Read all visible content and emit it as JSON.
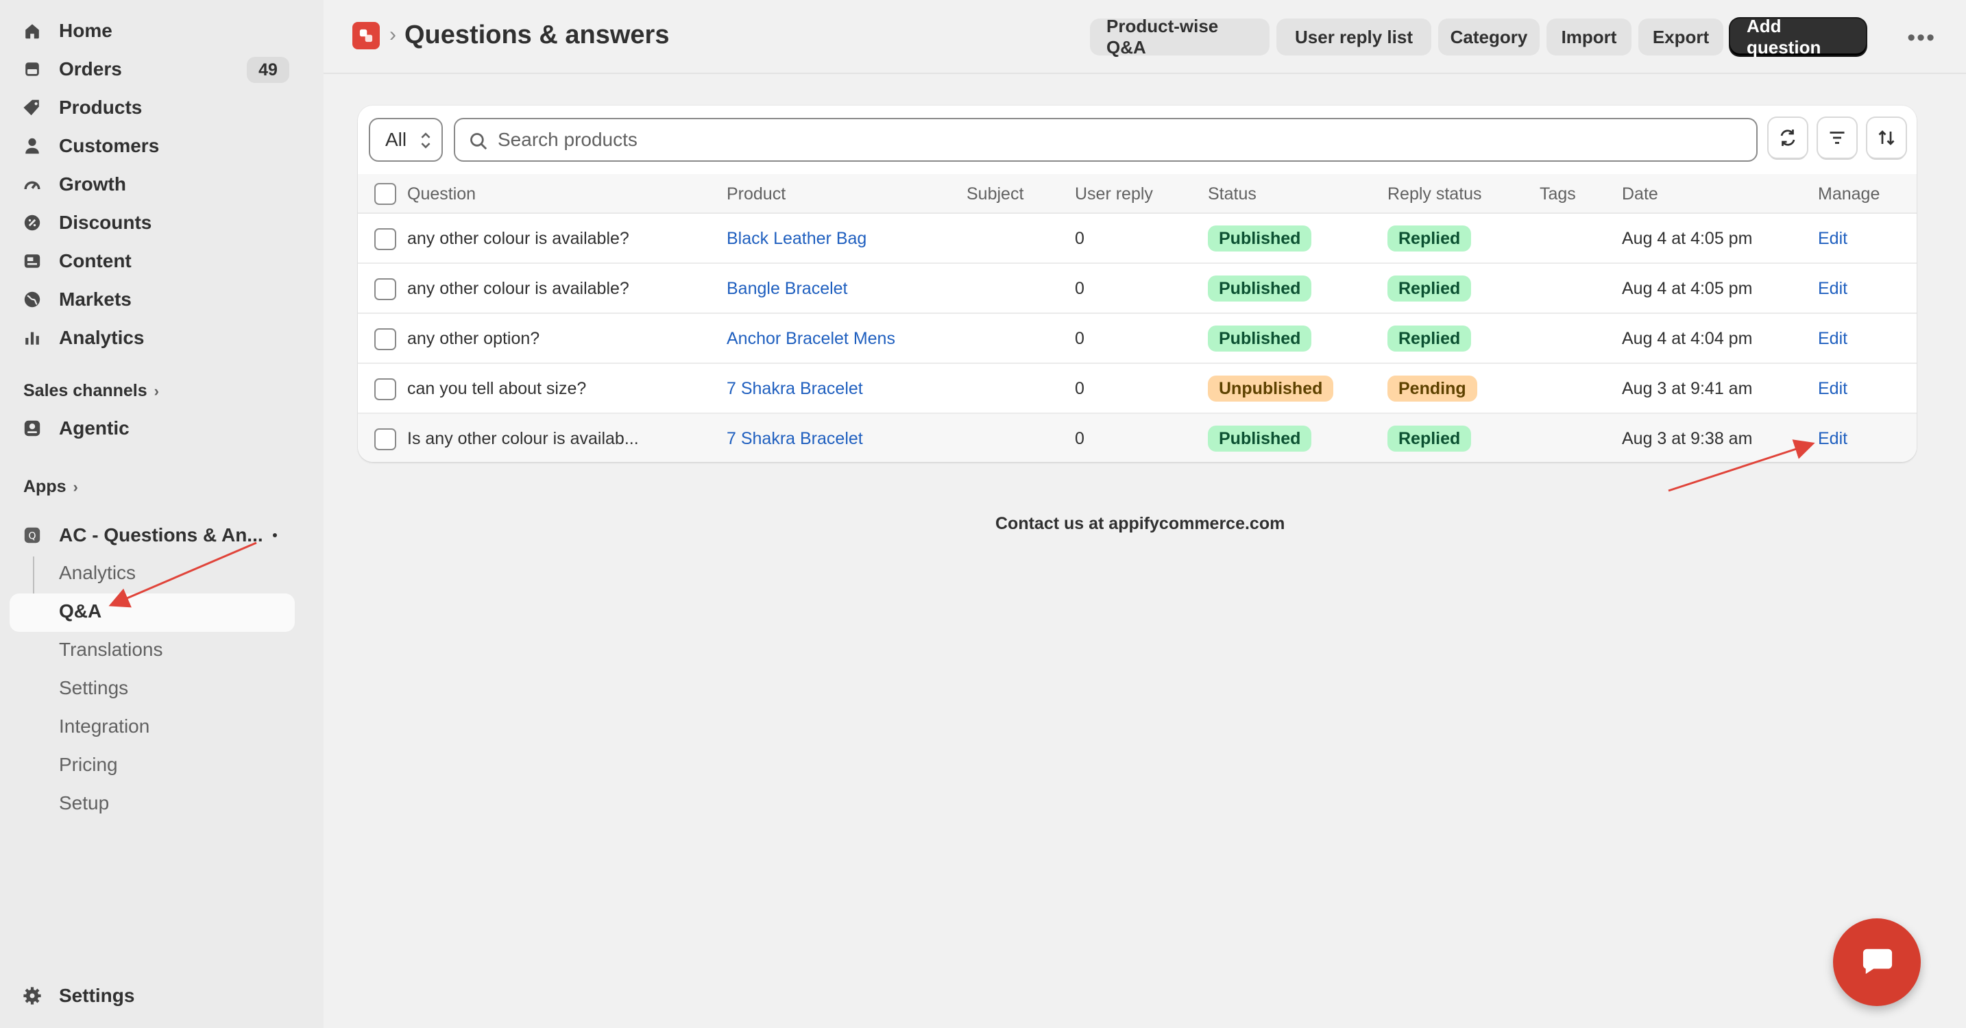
{
  "sidebar": {
    "nav": [
      {
        "label": "Home",
        "icon": "home-icon"
      },
      {
        "label": "Orders",
        "icon": "orders-icon",
        "badge": "49"
      },
      {
        "label": "Products",
        "icon": "tag-icon"
      },
      {
        "label": "Customers",
        "icon": "person-icon"
      },
      {
        "label": "Growth",
        "icon": "gauge-icon"
      },
      {
        "label": "Discounts",
        "icon": "discount-icon"
      },
      {
        "label": "Content",
        "icon": "content-icon"
      },
      {
        "label": "Markets",
        "icon": "globe-icon"
      },
      {
        "label": "Analytics",
        "icon": "bar-chart-icon"
      }
    ],
    "sales_channels": "Sales channels",
    "agentic": "Agentic",
    "apps": "Apps",
    "app_name": "AC - Questions & An...",
    "app_sub": [
      "Analytics",
      "Q&A",
      "Translations",
      "Settings",
      "Integration",
      "Pricing",
      "Setup"
    ],
    "settings": "Settings"
  },
  "header": {
    "title": "Questions & answers",
    "buttons": [
      "Product-wise Q&A",
      "User reply list",
      "Category",
      "Import",
      "Export"
    ],
    "primary": "Add question",
    "more": "•••"
  },
  "toolbar": {
    "filter_value": "All",
    "search_placeholder": "Search products"
  },
  "table": {
    "headers": [
      "Question",
      "Product",
      "Subject",
      "User reply",
      "Status",
      "Reply status",
      "Tags",
      "Date",
      "Manage"
    ],
    "rows": [
      {
        "question": "any other colour is available?",
        "product": "Black Leather Bag",
        "subject": "",
        "user_reply": "0",
        "status": "Published",
        "reply_status": "Replied",
        "tags": "",
        "date": "Aug 4 at 4:05 pm",
        "manage": "Edit"
      },
      {
        "question": "any other colour is available?",
        "product": "Bangle Bracelet",
        "subject": "",
        "user_reply": "0",
        "status": "Published",
        "reply_status": "Replied",
        "tags": "",
        "date": "Aug 4 at 4:05 pm",
        "manage": "Edit"
      },
      {
        "question": "any other option?",
        "product": "Anchor Bracelet Mens",
        "subject": "",
        "user_reply": "0",
        "status": "Published",
        "reply_status": "Replied",
        "tags": "",
        "date": "Aug 4 at 4:04 pm",
        "manage": "Edit"
      },
      {
        "question": "can you tell about size?",
        "product": "7 Shakra Bracelet",
        "subject": "",
        "user_reply": "0",
        "status": "Unpublished",
        "reply_status": "Pending",
        "tags": "",
        "date": "Aug 3 at 9:41 am",
        "manage": "Edit"
      },
      {
        "question": "Is any other colour is availab...",
        "product": "7 Shakra Bracelet",
        "subject": "",
        "user_reply": "0",
        "status": "Published",
        "reply_status": "Replied",
        "tags": "",
        "date": "Aug 3 at 9:38 am",
        "manage": "Edit"
      }
    ]
  },
  "footer": {
    "contact": "Contact us at appifycommerce.com"
  },
  "colors": {
    "accent": "#303030",
    "link": "#1f5fbf",
    "published": "#b4f5c8",
    "pending": "#ffd6a4",
    "annotation_arrow": "#e0443a",
    "chat_fab": "#d53d2e"
  }
}
